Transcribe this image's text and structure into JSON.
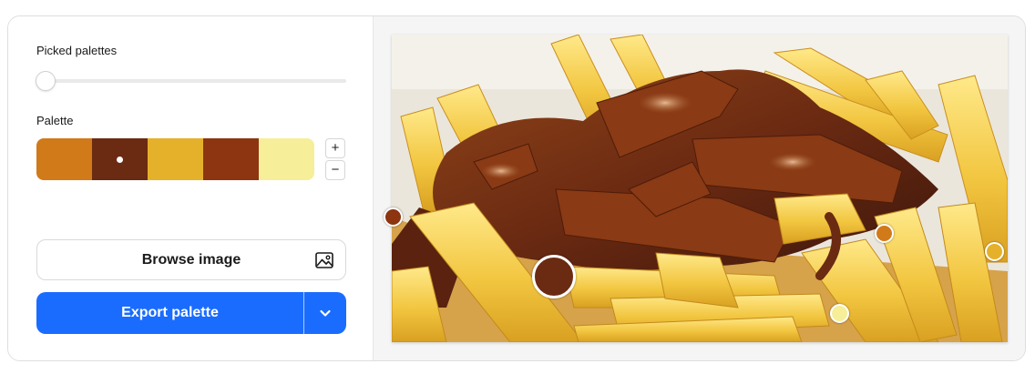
{
  "picked_palettes": {
    "label": "Picked palettes",
    "value": 0
  },
  "palette": {
    "label": "Palette",
    "selected_index": 1,
    "swatches": [
      {
        "color": "#d17a19"
      },
      {
        "color": "#6b2a12"
      },
      {
        "color": "#e6b12a"
      },
      {
        "color": "#8c3510"
      },
      {
        "color": "#f6ee99"
      }
    ],
    "add_label": "+",
    "remove_label": "−"
  },
  "browse_button": {
    "label": "Browse image",
    "icon": "image-icon"
  },
  "export_button": {
    "label": "Export palette",
    "dropdown_icon": "chevron-down-icon"
  },
  "image": {
    "subject": "poutine-fries-photo",
    "pickers": [
      {
        "color": "#8c3510"
      },
      {
        "color": "#6b2a12"
      },
      {
        "color": "#d17a19"
      },
      {
        "color": "#e6b12a"
      },
      {
        "color": "#f6ee99"
      }
    ]
  },
  "colors": {
    "accent": "#1a6cff",
    "panel_bg": "#f5f5f5",
    "border": "#dedede"
  }
}
